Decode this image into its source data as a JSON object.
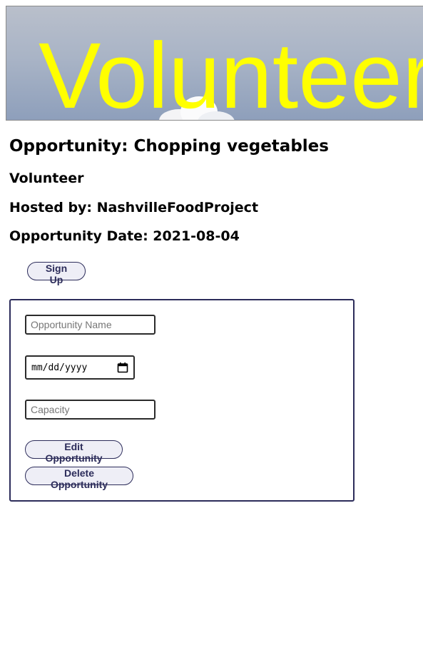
{
  "banner": {
    "title": "VolunteerHub"
  },
  "opportunity": {
    "title": "Opportunity: Chopping vegetables",
    "role": "Volunteer",
    "hosted_by": "Hosted by: NashvilleFoodProject",
    "date": "Opportunity Date: 2021-08-04"
  },
  "actions": {
    "signup_label": "Sign Up"
  },
  "edit_form": {
    "name_placeholder": "Opportunity Name",
    "date_placeholder": "mm/dd/yyyy",
    "capacity_placeholder": "Capacity",
    "edit_label": "Edit Opportunity",
    "delete_label": "Delete Opportunity"
  },
  "colors": {
    "banner_text": "#ffff00",
    "accent": "#2c2c5a"
  },
  "icons": {
    "date_picker": "calendar-icon"
  }
}
